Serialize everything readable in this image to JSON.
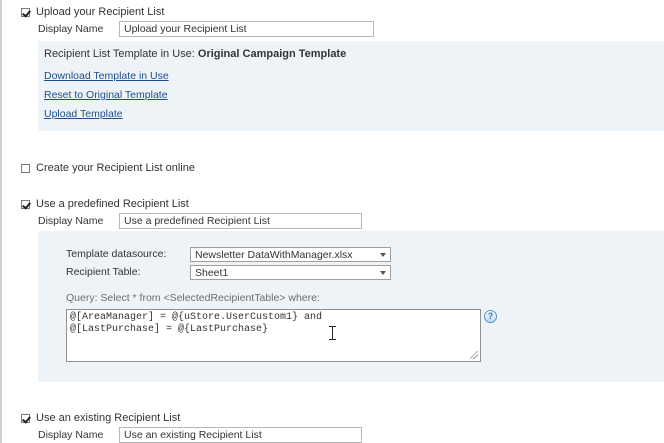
{
  "sections": {
    "upload": {
      "checked": true,
      "header": "Upload your Recipient List",
      "display_name_label": "Display Name",
      "display_name_value": "Upload your Recipient List",
      "template_in_use_label": "Recipient List Template in Use:",
      "template_in_use_value": "Original Campaign Template",
      "links": [
        "Download Template in Use",
        "Reset to Original Template",
        "Upload Template"
      ]
    },
    "create_online": {
      "checked": false,
      "header": "Create your Recipient List online"
    },
    "predefined": {
      "checked": true,
      "header": "Use a predefined Recipient List",
      "display_name_label": "Display Name",
      "display_name_value": "Use a predefined Recipient List",
      "template_datasource_label": "Template datasource:",
      "template_datasource_value": "Newsletter DataWithManager.xlsx",
      "recipient_table_label": "Recipient Table:",
      "recipient_table_value": "Sheet1",
      "query_label": "Query: Select * from <SelectedRecipientTable> where:",
      "query_lines": [
        "@[AreaManager] = @{uStore.UserCustom1} and",
        "@[LastPurchase] = @{LastPurchase}"
      ],
      "help_icon": "help-icon"
    },
    "existing": {
      "checked": true,
      "header": "Use an existing Recipient List",
      "display_name_label": "Display Name",
      "display_name_value": "Use an existing Recipient List"
    }
  }
}
